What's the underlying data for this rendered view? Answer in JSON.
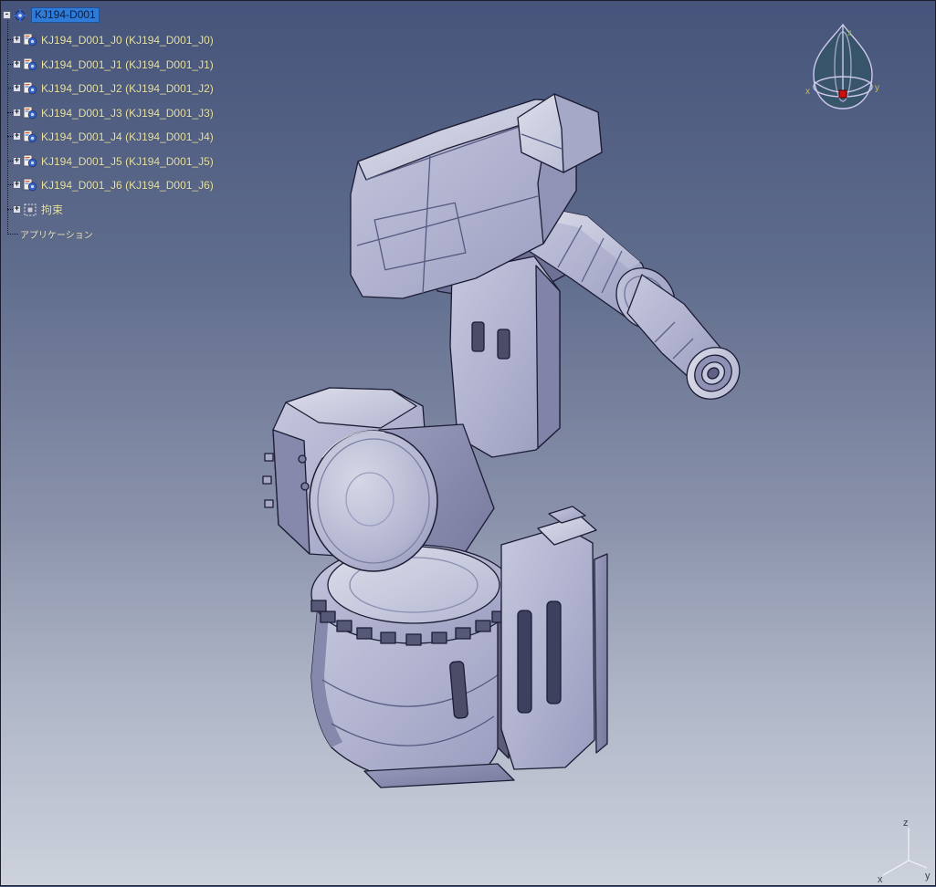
{
  "colors": {
    "background_top": "#46547B",
    "background_bottom": "#CDD2DC",
    "selection_blue": "#2E7CD8",
    "tree_text_yellow": "#EAE5A6",
    "model_lavender": "#AFB2D2",
    "compass_red": "#CC1111"
  },
  "tree": {
    "collapse_symbol": "-",
    "expand_symbol": "+",
    "root": {
      "label": "KJ194-D001"
    },
    "items": [
      {
        "label": "KJ194_D001_J0 (KJ194_D001_J0)"
      },
      {
        "label": "KJ194_D001_J1 (KJ194_D001_J1)"
      },
      {
        "label": "KJ194_D001_J2 (KJ194_D001_J2)"
      },
      {
        "label": "KJ194_D001_J3 (KJ194_D001_J3)"
      },
      {
        "label": "KJ194_D001_J4 (KJ194_D001_J4)"
      },
      {
        "label": "KJ194_D001_J5 (KJ194_D001_J5)"
      },
      {
        "label": "KJ194_D001_J6 (KJ194_D001_J6)"
      },
      {
        "label": "拘束"
      },
      {
        "label": "アプリケーション"
      }
    ]
  },
  "compass": {
    "x_label": "x",
    "y_label": "y",
    "z_label": "z"
  },
  "triad": {
    "x_label": "x",
    "y_label": "y",
    "z_label": "z"
  }
}
